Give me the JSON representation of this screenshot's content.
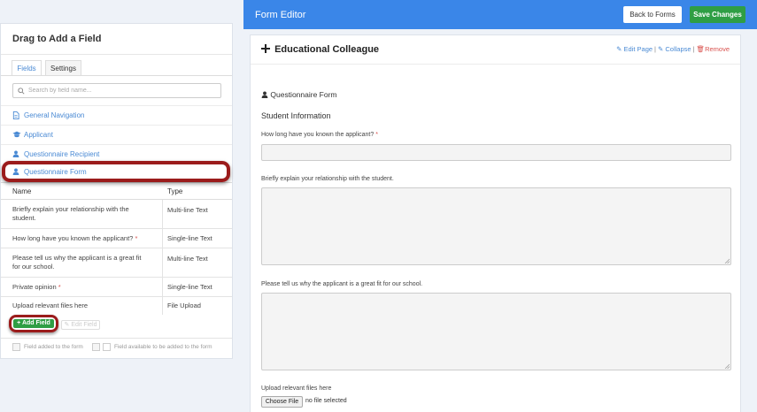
{
  "left_panel": {
    "title": "Drag to Add a Field",
    "tabs": [
      {
        "label": "Fields",
        "active": true
      },
      {
        "label": "Settings",
        "active": false
      }
    ],
    "search": {
      "placeholder": "Search by field name..."
    },
    "nav_items": [
      {
        "label": "General Navigation",
        "icon": "document-icon"
      },
      {
        "label": "Applicant",
        "icon": "graduation-cap-icon"
      },
      {
        "label": "Questionnaire Recipient",
        "icon": "user-icon"
      },
      {
        "label": "Questionnaire Form",
        "icon": "user-icon"
      }
    ],
    "table": {
      "headers": [
        "Name",
        "Type"
      ],
      "rows": [
        {
          "name": "Briefly explain your relationship with the student.",
          "type": "Multi-line Text",
          "required": false
        },
        {
          "name": "How long have you known the applicant?",
          "type": "Single-line Text",
          "required": true
        },
        {
          "name": "Please tell us why the applicant is a great fit for our school.",
          "type": "Multi-line Text",
          "required": false
        },
        {
          "name": "Private opinion",
          "type": "Single-line Text",
          "required": true
        },
        {
          "name": "Upload relevant files here",
          "type": "File Upload",
          "required": false
        }
      ]
    },
    "add_field_label": "Add Field",
    "edit_field_label": "Edit Field",
    "legend": {
      "added": "Field added to the form",
      "available": "Field available to be added to the form"
    }
  },
  "header": {
    "title": "Form Editor",
    "back_label": "Back to Forms",
    "save_label": "Save Changes"
  },
  "editor": {
    "page_title": "Educational Colleague",
    "actions": {
      "edit": "Edit Page",
      "collapse": "Collapse",
      "remove": "Remove"
    },
    "section_title": "Questionnaire Form",
    "subsection_title": "Student Information",
    "fields": [
      {
        "label": "How long have you known the applicant?",
        "required": true
      },
      {
        "label": "Briefly explain your relationship with the student.",
        "required": false
      },
      {
        "label": "Please tell us why the applicant is a great fit for our school.",
        "required": false
      },
      {
        "label": "Upload relevant files here",
        "required": false
      }
    ],
    "file": {
      "button": "Choose File",
      "status": "no file selected"
    }
  },
  "colors": {
    "header_bg": "#3a86e8",
    "accent_link": "#4a8ad4",
    "success": "#2f9e44",
    "danger": "#d9534f",
    "highlight_ring": "#9b1c1c"
  }
}
